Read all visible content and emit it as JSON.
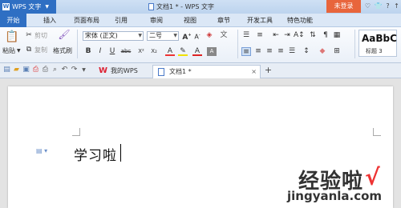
{
  "titlebar": {
    "app_name": "WPS 文字",
    "doc_title": "文档1 * - WPS 文字",
    "login_label": "未登录",
    "icons": [
      "skin-icon",
      "shirt-icon",
      "help-icon",
      "collapse-icon"
    ],
    "icon_glyphs": [
      "♡",
      "👕",
      "?",
      "↑"
    ]
  },
  "menu": {
    "tabs": [
      "开始",
      "插入",
      "页面布局",
      "引用",
      "审阅",
      "视图",
      "章节",
      "开发工具",
      "特色功能"
    ]
  },
  "ribbon": {
    "paste_label": "粘贴",
    "cut_label": "剪切",
    "copy_label": "复制",
    "format_painter_label": "格式刷",
    "font_name": "宋体 (正文)",
    "font_size": "二号",
    "bold": "B",
    "italic": "I",
    "underline": "U",
    "strike": "abc",
    "superscript": "X²",
    "subscript": "X₂",
    "style_preview": "AaBbC",
    "style_name": "标题 3"
  },
  "doc_tabs": {
    "tab1_label": "我的WPS",
    "tab2_label": "文档1 *",
    "add_label": "+"
  },
  "document": {
    "text": "学习啦"
  },
  "watermark": {
    "text": "经验啦",
    "check": "√",
    "url": "jingyanla.com"
  },
  "colors": {
    "accent": "#2f6fc3",
    "login": "#e8653c"
  }
}
